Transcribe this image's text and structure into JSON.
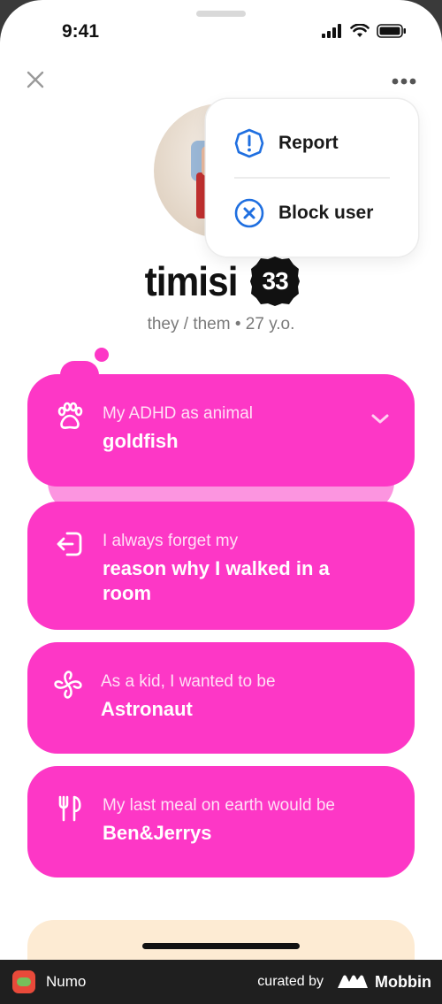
{
  "status_bar": {
    "time": "9:41"
  },
  "profile": {
    "name": "timisi",
    "age_badge": "33",
    "subtitle": "they / them • 27 y.o."
  },
  "menu": {
    "items": [
      {
        "label": "Report",
        "icon": "exclamation-circle-icon"
      },
      {
        "label": "Block user",
        "icon": "x-circle-icon"
      }
    ]
  },
  "cards": [
    {
      "icon": "paw-icon",
      "label": "My ADHD as animal",
      "value": "goldfish",
      "expandable": true
    },
    {
      "icon": "door-enter-icon",
      "label": "I always forget my",
      "value": "reason why I walked in a room"
    },
    {
      "icon": "pinwheel-icon",
      "label": "As a kid, I wanted to be",
      "value": "Astronaut"
    },
    {
      "icon": "fork-knife-icon",
      "label": "My last meal on earth would be",
      "value": "Ben&Jerrys"
    }
  ],
  "footer": {
    "app_name": "Numo",
    "curated_by": "curated by",
    "brand": "Mobbin"
  },
  "colors": {
    "accent_pink": "#fd37c6",
    "menu_icon_blue": "#1f6fe0"
  }
}
